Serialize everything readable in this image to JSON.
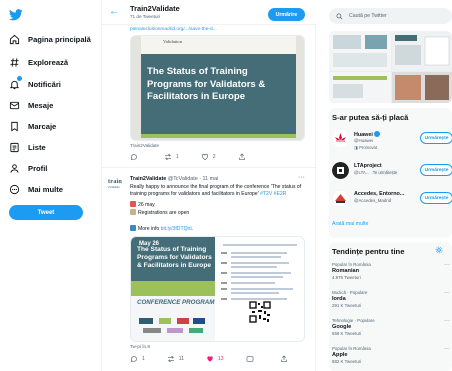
{
  "nav": {
    "items": [
      {
        "label": "Pagina principală",
        "icon": "home-icon"
      },
      {
        "label": "Explorează",
        "icon": "hashtag-icon"
      },
      {
        "label": "Notificări",
        "icon": "bell-icon"
      },
      {
        "label": "Mesaje",
        "icon": "mail-icon"
      },
      {
        "label": "Marcaje",
        "icon": "bookmark-icon"
      },
      {
        "label": "Liste",
        "icon": "list-icon"
      },
      {
        "label": "Profil",
        "icon": "profile-icon"
      },
      {
        "label": "Mai multe",
        "icon": "more-icon"
      }
    ],
    "tweet_button": "Tweet"
  },
  "header": {
    "title": "Train2Validate",
    "tweet_count": "71 de Tweeturi",
    "follow_label": "Urmărire"
  },
  "tweet1": {
    "link": "plenainclusionmadrid.org/.../save-the-d...",
    "card_title": "The Status of Training Programs for Validators & Facilitators in Europe",
    "card_paper_text": "Validation",
    "source": "Train2Validate",
    "replies": "",
    "retweets": "1",
    "likes": "2"
  },
  "tweet2": {
    "avatar_top": "train",
    "avatar_bottom": "2validate",
    "name": "Train2Validate",
    "handle": "@TcValidate · 11 mai",
    "text_plain": "Really happy to announce the final program of the conference 'The status of training programs for validators and facilitators in Europe' ",
    "text_tags": "#T2V #E2R",
    "date_line": "26 may",
    "reg_line": "Registrations are open",
    "more_info": "More info ",
    "more_info_link": "bit.ly/3fDTQnL",
    "card_title": "The Status of Training Programs for Validators & Facilitators in Europe",
    "card_date": "May 26",
    "card_program": "CONFERENCE PROGRAM",
    "source": "Tw-pi în.8",
    "replies": "1",
    "retweets": "11",
    "likes": "13"
  },
  "right": {
    "search_placeholder": "Caută pe Twitter",
    "who_title": "S-ar putea să-ți placă",
    "who": [
      {
        "name": "Huawei",
        "handle": "@Huawei",
        "tag": "Promovat",
        "follow": "Urmărește"
      },
      {
        "name": "LTAproject",
        "handle": "@LTA...",
        "tag": "Te urmărește",
        "follow": "Urmărește"
      },
      {
        "name": "Accedes, Entorno...",
        "handle": "@Accedes_Madrid",
        "tag": "",
        "follow": "Urmărește"
      }
    ],
    "show_more": "Arată mai multe",
    "trends_title": "Tendințe pentru tine",
    "trends": [
      {
        "context": "Popular în România",
        "title": "Romanian",
        "count": "4.975 Tweeturi"
      },
      {
        "context": "Muzică · Populare",
        "title": "Iorda",
        "count": "291 K Tweeturi"
      },
      {
        "context": "Tehnologie · Populare",
        "title": "Google",
        "count": "659 K Tweeturi"
      },
      {
        "context": "Popular în România",
        "title": "Apple",
        "count": "882 K Tweeturi"
      }
    ]
  },
  "colors": {
    "accent": "#1d9bf0",
    "card_teal": "#446d78",
    "card_green": "#9cc15a",
    "like_red": "#f91880"
  }
}
